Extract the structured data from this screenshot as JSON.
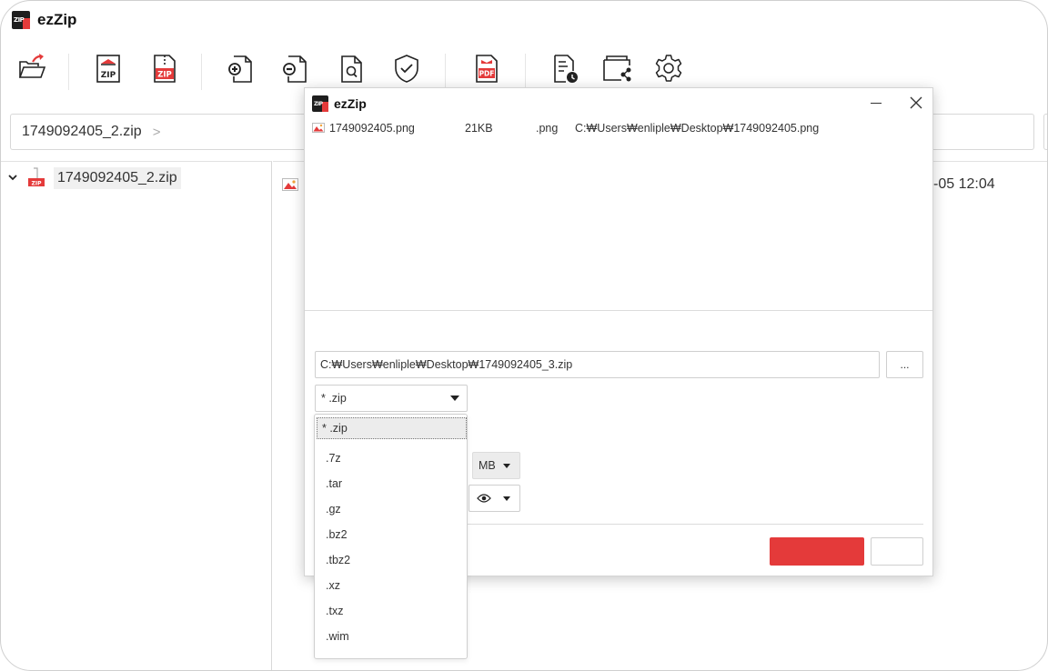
{
  "app": {
    "title": "ezZip",
    "logo_text": "ZIP"
  },
  "toolbar": {
    "buttons": [
      {
        "name": "open-archive-icon"
      },
      {
        "name": "compress-zip-icon",
        "text": "ZIP"
      },
      {
        "name": "extract-zip-icon",
        "text": "ZIP"
      },
      {
        "name": "add-file-icon"
      },
      {
        "name": "remove-file-icon"
      },
      {
        "name": "view-file-icon"
      },
      {
        "name": "check-integrity-icon"
      },
      {
        "name": "convert-pdf-icon",
        "text": "PDF"
      },
      {
        "name": "history-icon"
      },
      {
        "name": "share-icon"
      },
      {
        "name": "settings-gear-icon"
      }
    ]
  },
  "pathbar": {
    "path": "1749092405_2.zip",
    "separator": ">"
  },
  "tree": {
    "root_label": "1749092405_2.zip",
    "zip_text": "ZIP"
  },
  "main": {
    "date_fragment": "-05 12:04"
  },
  "dialog": {
    "title": "ezZip",
    "file": {
      "name": "1749092405.png",
      "size": "21KB",
      "ext": ".png",
      "path": "C:₩Users₩enliple₩Desktop₩1749092405.png"
    },
    "destination": "C:₩Users₩enliple₩Desktop₩1749092405_3.zip",
    "browse_label": "...",
    "format_selected": "* .zip",
    "split_unit": "MB",
    "ok_label": "",
    "cancel_label": ""
  },
  "dropdown": {
    "options": [
      "* .zip",
      ".7z",
      ".tar",
      ".gz",
      ".bz2",
      ".tbz2",
      ".xz",
      ".txz",
      ".wim"
    ]
  },
  "colors": {
    "accent": "#e43a3a",
    "text": "#333333",
    "border": "#cfcfcf"
  }
}
